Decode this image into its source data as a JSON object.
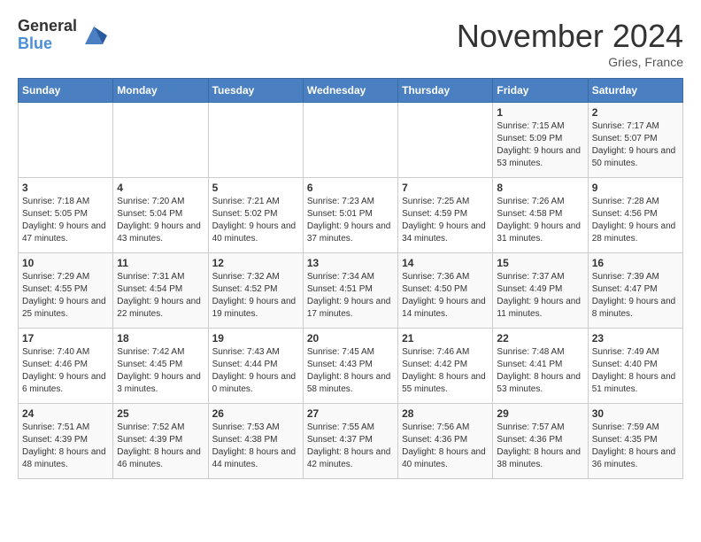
{
  "header": {
    "logo_general": "General",
    "logo_blue": "Blue",
    "title": "November 2024",
    "location": "Gries, France"
  },
  "days_of_week": [
    "Sunday",
    "Monday",
    "Tuesday",
    "Wednesday",
    "Thursday",
    "Friday",
    "Saturday"
  ],
  "weeks": [
    [
      {
        "day": "",
        "info": ""
      },
      {
        "day": "",
        "info": ""
      },
      {
        "day": "",
        "info": ""
      },
      {
        "day": "",
        "info": ""
      },
      {
        "day": "",
        "info": ""
      },
      {
        "day": "1",
        "info": "Sunrise: 7:15 AM\nSunset: 5:09 PM\nDaylight: 9 hours and 53 minutes."
      },
      {
        "day": "2",
        "info": "Sunrise: 7:17 AM\nSunset: 5:07 PM\nDaylight: 9 hours and 50 minutes."
      }
    ],
    [
      {
        "day": "3",
        "info": "Sunrise: 7:18 AM\nSunset: 5:05 PM\nDaylight: 9 hours and 47 minutes."
      },
      {
        "day": "4",
        "info": "Sunrise: 7:20 AM\nSunset: 5:04 PM\nDaylight: 9 hours and 43 minutes."
      },
      {
        "day": "5",
        "info": "Sunrise: 7:21 AM\nSunset: 5:02 PM\nDaylight: 9 hours and 40 minutes."
      },
      {
        "day": "6",
        "info": "Sunrise: 7:23 AM\nSunset: 5:01 PM\nDaylight: 9 hours and 37 minutes."
      },
      {
        "day": "7",
        "info": "Sunrise: 7:25 AM\nSunset: 4:59 PM\nDaylight: 9 hours and 34 minutes."
      },
      {
        "day": "8",
        "info": "Sunrise: 7:26 AM\nSunset: 4:58 PM\nDaylight: 9 hours and 31 minutes."
      },
      {
        "day": "9",
        "info": "Sunrise: 7:28 AM\nSunset: 4:56 PM\nDaylight: 9 hours and 28 minutes."
      }
    ],
    [
      {
        "day": "10",
        "info": "Sunrise: 7:29 AM\nSunset: 4:55 PM\nDaylight: 9 hours and 25 minutes."
      },
      {
        "day": "11",
        "info": "Sunrise: 7:31 AM\nSunset: 4:54 PM\nDaylight: 9 hours and 22 minutes."
      },
      {
        "day": "12",
        "info": "Sunrise: 7:32 AM\nSunset: 4:52 PM\nDaylight: 9 hours and 19 minutes."
      },
      {
        "day": "13",
        "info": "Sunrise: 7:34 AM\nSunset: 4:51 PM\nDaylight: 9 hours and 17 minutes."
      },
      {
        "day": "14",
        "info": "Sunrise: 7:36 AM\nSunset: 4:50 PM\nDaylight: 9 hours and 14 minutes."
      },
      {
        "day": "15",
        "info": "Sunrise: 7:37 AM\nSunset: 4:49 PM\nDaylight: 9 hours and 11 minutes."
      },
      {
        "day": "16",
        "info": "Sunrise: 7:39 AM\nSunset: 4:47 PM\nDaylight: 9 hours and 8 minutes."
      }
    ],
    [
      {
        "day": "17",
        "info": "Sunrise: 7:40 AM\nSunset: 4:46 PM\nDaylight: 9 hours and 6 minutes."
      },
      {
        "day": "18",
        "info": "Sunrise: 7:42 AM\nSunset: 4:45 PM\nDaylight: 9 hours and 3 minutes."
      },
      {
        "day": "19",
        "info": "Sunrise: 7:43 AM\nSunset: 4:44 PM\nDaylight: 9 hours and 0 minutes."
      },
      {
        "day": "20",
        "info": "Sunrise: 7:45 AM\nSunset: 4:43 PM\nDaylight: 8 hours and 58 minutes."
      },
      {
        "day": "21",
        "info": "Sunrise: 7:46 AM\nSunset: 4:42 PM\nDaylight: 8 hours and 55 minutes."
      },
      {
        "day": "22",
        "info": "Sunrise: 7:48 AM\nSunset: 4:41 PM\nDaylight: 8 hours and 53 minutes."
      },
      {
        "day": "23",
        "info": "Sunrise: 7:49 AM\nSunset: 4:40 PM\nDaylight: 8 hours and 51 minutes."
      }
    ],
    [
      {
        "day": "24",
        "info": "Sunrise: 7:51 AM\nSunset: 4:39 PM\nDaylight: 8 hours and 48 minutes."
      },
      {
        "day": "25",
        "info": "Sunrise: 7:52 AM\nSunset: 4:39 PM\nDaylight: 8 hours and 46 minutes."
      },
      {
        "day": "26",
        "info": "Sunrise: 7:53 AM\nSunset: 4:38 PM\nDaylight: 8 hours and 44 minutes."
      },
      {
        "day": "27",
        "info": "Sunrise: 7:55 AM\nSunset: 4:37 PM\nDaylight: 8 hours and 42 minutes."
      },
      {
        "day": "28",
        "info": "Sunrise: 7:56 AM\nSunset: 4:36 PM\nDaylight: 8 hours and 40 minutes."
      },
      {
        "day": "29",
        "info": "Sunrise: 7:57 AM\nSunset: 4:36 PM\nDaylight: 8 hours and 38 minutes."
      },
      {
        "day": "30",
        "info": "Sunrise: 7:59 AM\nSunset: 4:35 PM\nDaylight: 8 hours and 36 minutes."
      }
    ]
  ]
}
